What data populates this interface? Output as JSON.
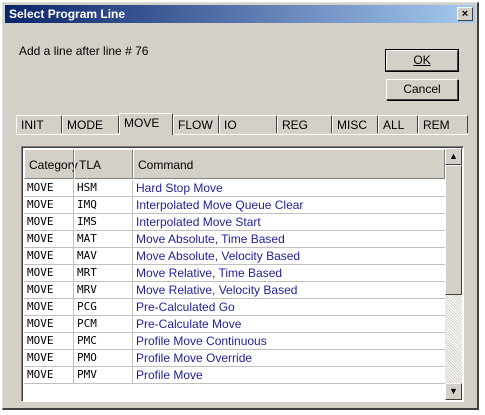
{
  "window": {
    "title": "Select Program Line",
    "close_glyph": "×"
  },
  "prompt": "Add a line after line # 76",
  "buttons": {
    "ok": "OK",
    "cancel": "Cancel"
  },
  "tabs": [
    {
      "label": "INIT",
      "active": false
    },
    {
      "label": "MODE",
      "active": false
    },
    {
      "label": "MOVE",
      "active": true
    },
    {
      "label": "FLOW",
      "active": false
    },
    {
      "label": "IO",
      "active": false
    },
    {
      "label": "REG",
      "active": false
    },
    {
      "label": "MISC",
      "active": false
    },
    {
      "label": "ALL",
      "active": false
    },
    {
      "label": "REM",
      "active": false
    }
  ],
  "list": {
    "columns": [
      "Category",
      "TLA",
      "Command"
    ],
    "rows": [
      [
        "MOVE",
        "HSM",
        "Hard Stop Move"
      ],
      [
        "MOVE",
        "IMQ",
        "Interpolated Move Queue Clear"
      ],
      [
        "MOVE",
        "IMS",
        "Interpolated Move Start"
      ],
      [
        "MOVE",
        "MAT",
        "Move Absolute, Time Based"
      ],
      [
        "MOVE",
        "MAV",
        "Move Absolute, Velocity Based"
      ],
      [
        "MOVE",
        "MRT",
        "Move Relative, Time Based"
      ],
      [
        "MOVE",
        "MRV",
        "Move Relative, Velocity Based"
      ],
      [
        "MOVE",
        "PCG",
        "Pre-Calculated Go"
      ],
      [
        "MOVE",
        "PCM",
        "Pre-Calculate Move"
      ],
      [
        "MOVE",
        "PMC",
        "Profile Move Continuous"
      ],
      [
        "MOVE",
        "PMO",
        "Profile Move Override"
      ],
      [
        "MOVE",
        "PMV",
        "Profile Move"
      ]
    ]
  },
  "scrollbar": {
    "up_icon": "▲",
    "down_icon": "▼"
  },
  "colors": {
    "title_start": "#0a246a",
    "title_end": "#a6caf0",
    "command_text": "#1f1f9e"
  }
}
